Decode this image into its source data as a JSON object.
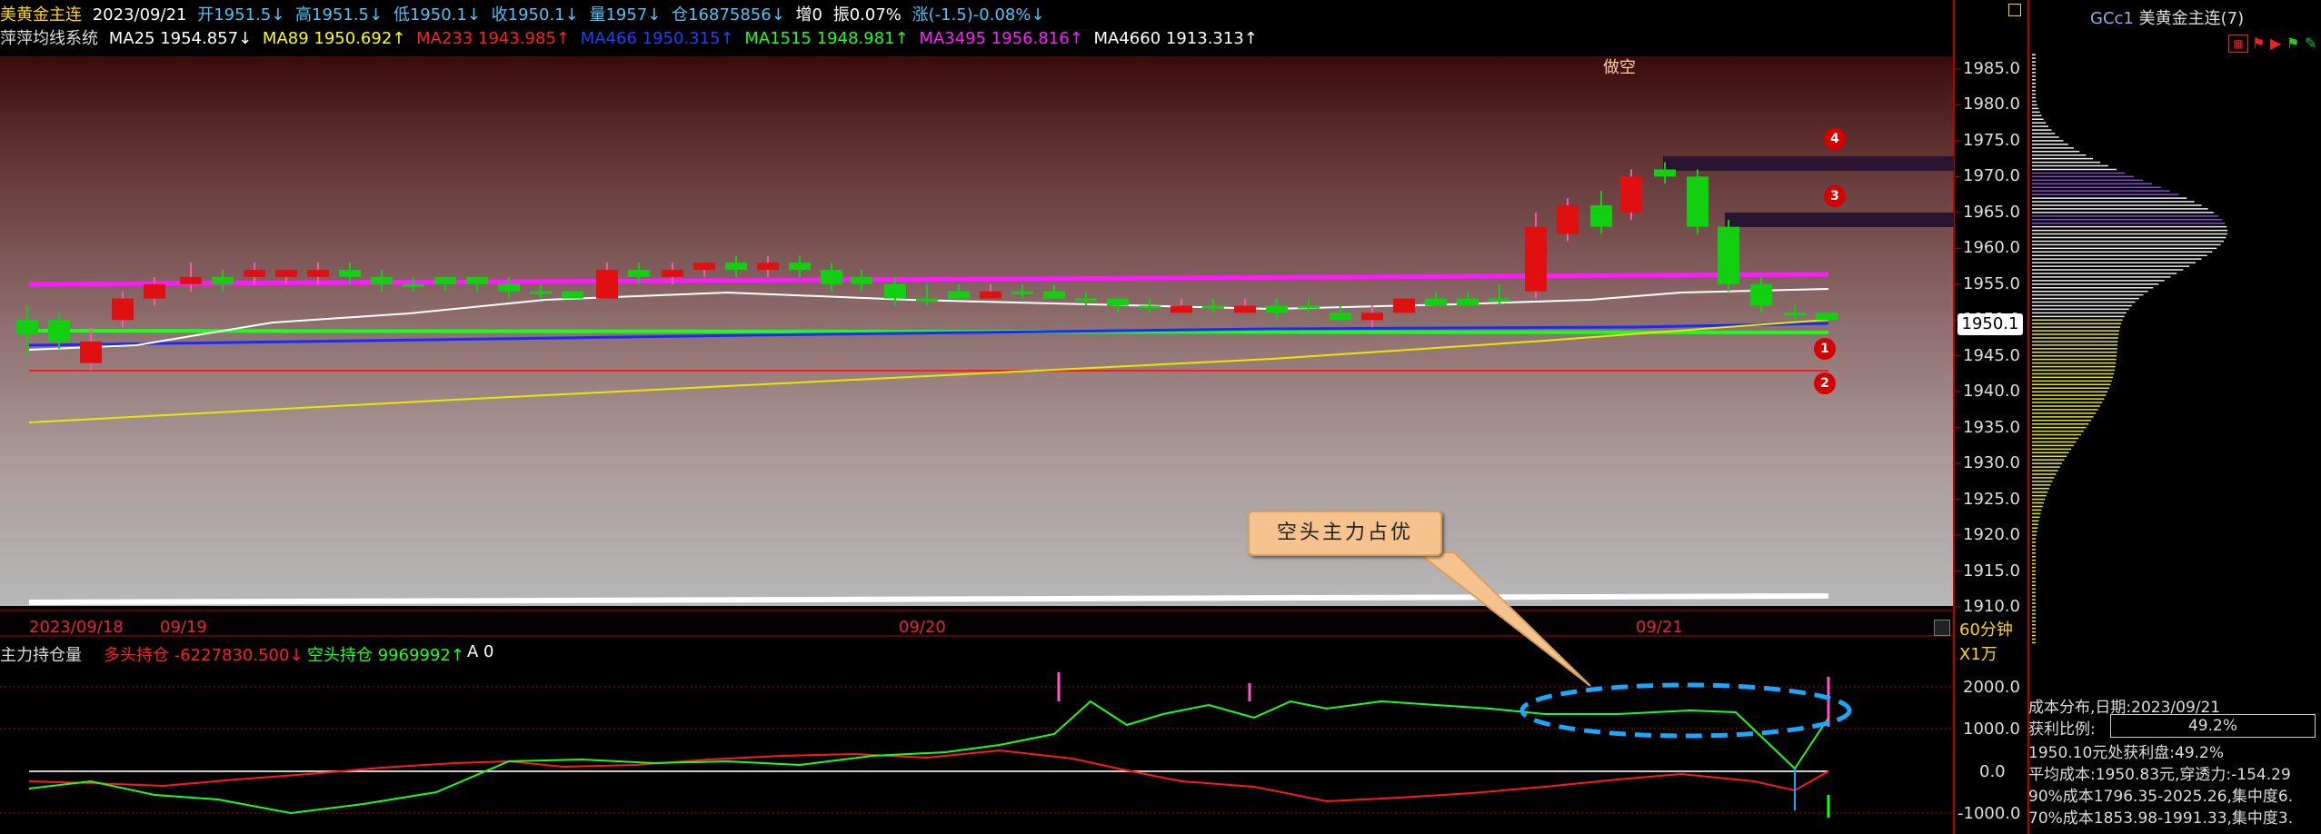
{
  "header": {
    "symbol": "美黄金主连",
    "date": "2023/09/21",
    "open": "开1951.5↓",
    "high": "高1951.5↓",
    "low": "低1950.1↓",
    "close": "收1950.1↓",
    "volume": "量1957↓",
    "position": "仓16875856↓",
    "increase": "增0",
    "amplitude": "振0.07%",
    "change": "涨(-1.5)-0.08%↓"
  },
  "ma_bar": {
    "system": "萍萍均线系统",
    "items": [
      {
        "label": "MA25 1954.857↓",
        "color": "#ffffff"
      },
      {
        "label": "MA89 1950.692↑",
        "color": "#ffff00"
      },
      {
        "label": "MA233 1943.985↑",
        "color": "#ff2020"
      },
      {
        "label": "MA466 1950.315↑",
        "color": "#2040ff"
      },
      {
        "label": "MA1515 1948.981↑",
        "color": "#20ff20"
      },
      {
        "label": "MA3495 1956.816↑",
        "color": "#ff20ff"
      },
      {
        "label": "MA4660 1913.313↑",
        "color": "#ffffff"
      }
    ]
  },
  "main_chart": {
    "annotation_top": "做空",
    "price_ticks": [
      "1985.0",
      "1980.0",
      "1975.0",
      "1970.0",
      "1965.0",
      "1960.0",
      "1955.0",
      "1950.0",
      "1945.0",
      "1940.0",
      "1935.0",
      "1930.0",
      "1925.0",
      "1920.0",
      "1915.0",
      "1910.0"
    ],
    "current_price": "1950.1",
    "period": "60分钟",
    "date_labels": [
      "2023/09/18",
      "09/19",
      "09/20",
      "09/21"
    ],
    "markers": [
      "4",
      "3",
      "1",
      "2"
    ]
  },
  "indicator": {
    "name": "主力持仓量",
    "long_label": "多头持仓 -6227830.500↓",
    "short_label": "空头持仓 9969992↑",
    "a_label": "A 0",
    "scale_label": "X1万",
    "ticks": [
      "2000.0",
      "1000.0",
      "0.0",
      "-1000.0"
    ],
    "callout": "空头主力占优"
  },
  "right_panel": {
    "title_code": "GCc1",
    "title_name": "美黄金主连(7)",
    "dist_date": "成本分布,日期:2023/09/21",
    "profit_ratio_label": "获利比例:",
    "profit_ratio_value": "49.2%",
    "line1": "1950.10元处获利盘:49.2%",
    "line2": "平均成本:1950.83元,穿透力:-154.29",
    "line3": "90%成本1796.35-2025.26,集中度6.",
    "line4": "70%成本1853.98-1991.33,集中度3."
  },
  "colors": {
    "up": "#e01010",
    "down": "#10d010",
    "ma_white": "#ffffff",
    "ma_yellow": "#e8e800",
    "ma_red": "#ff1a1a",
    "ma_blue": "#1a2aff",
    "ma_green": "#1aff1a",
    "ma_magenta": "#ff1aff",
    "callout_ellipse": "#1aa8ff"
  }
}
